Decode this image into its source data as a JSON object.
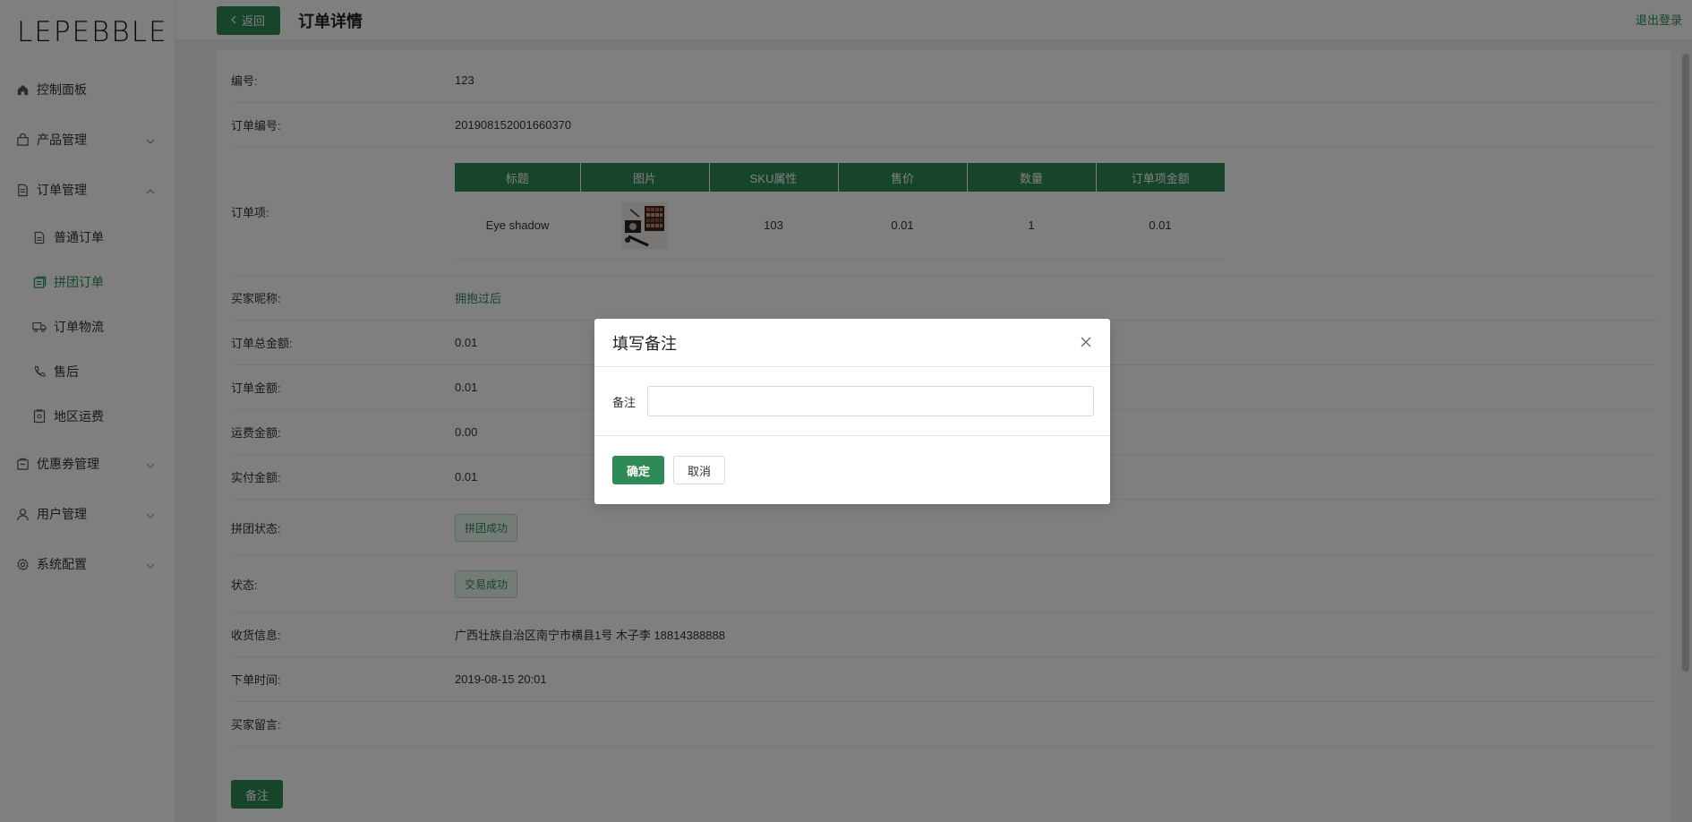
{
  "app": {
    "logo": "LEPEBBLE",
    "logout": "退出登录"
  },
  "sidebar": {
    "items": [
      {
        "label": "控制面板",
        "icon": "home-icon"
      },
      {
        "label": "产品管理",
        "icon": "bag-icon"
      },
      {
        "label": "订单管理",
        "icon": "document-icon"
      },
      {
        "label": "优惠券管理",
        "icon": "coupon-icon"
      },
      {
        "label": "用户管理",
        "icon": "user-icon"
      },
      {
        "label": "系统配置",
        "icon": "gear-icon"
      }
    ],
    "order_sub": [
      {
        "label": "普通订单",
        "icon": "file-icon"
      },
      {
        "label": "拼团订单",
        "icon": "group-icon",
        "active": true
      },
      {
        "label": "订单物流",
        "icon": "truck-icon"
      },
      {
        "label": "售后",
        "icon": "phone-icon"
      },
      {
        "label": "地区运费",
        "icon": "shipping-icon"
      }
    ]
  },
  "header": {
    "back_label": "返回",
    "title": "订单详情"
  },
  "detail": {
    "id_label": "编号:",
    "id_value": "123",
    "order_no_label": "订单编号:",
    "order_no_value": "201908152001660370",
    "items_label": "订单项:",
    "items_columns": [
      "标题",
      "图片",
      "SKU属性",
      "售价",
      "数量",
      "订单项金额"
    ],
    "items_rows": [
      {
        "title": "Eye shadow",
        "sku": "103",
        "price": "0.01",
        "qty": "1",
        "amount": "0.01"
      }
    ],
    "buyer_label": "买家昵称:",
    "buyer_value": "拥抱过后",
    "total_label": "订单总金额:",
    "total_value": "0.01",
    "amount_label": "订单金额:",
    "amount_value": "0.01",
    "freight_label": "运费金额:",
    "freight_value": "0.00",
    "paid_label": "实付金额:",
    "paid_value": "0.01",
    "group_status_label": "拼团状态:",
    "group_status_value": "拼团成功",
    "status_label": "状态:",
    "status_value": "交易成功",
    "address_label": "收货信息:",
    "address_value": "广西壮族自治区南宁市横县1号 木子李 18814388888",
    "order_time_label": "下单时间:",
    "order_time_value": "2019-08-15 20:01",
    "message_label": "买家留言:",
    "message_value": "",
    "note_button": "备注"
  },
  "modal": {
    "title": "填写备注",
    "field_label": "备注",
    "field_value": "",
    "field_placeholder": "",
    "ok_label": "确定",
    "cancel_label": "取消"
  },
  "colors": {
    "accent": "#2e8b57",
    "overlay": "rgba(0,0,0,0.5)"
  }
}
